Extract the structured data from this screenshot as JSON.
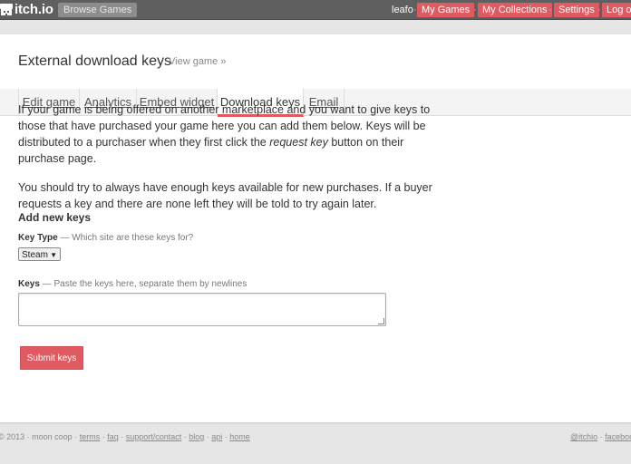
{
  "topbar": {
    "logo_text": "itch.io",
    "logo_icon": "itchio-logo-icon",
    "browse_label": "Browse Games",
    "username": "leafo",
    "nav": [
      "My Games",
      "My Collections",
      "Settings",
      "Log out"
    ],
    "separator": "·"
  },
  "header": {
    "title": "External download keys",
    "view_link": "View game »"
  },
  "tabs": [
    "Edit game",
    "Analytics",
    "Embed widget",
    "Download keys",
    "Email"
  ],
  "content": {
    "para1_a": "If your game is being offered on another marketplace and you want to give keys to those that have purchased your game here you can add them below. Keys will be distributed to a purchaser when they first click the ",
    "para1_em": "request key",
    "para1_b": " button on their purchase page.",
    "para2": "You should try to always have enough keys available for new purchases. If a buyer requests a key and there are none left they will be told to try again later.",
    "section_title": "Add new keys",
    "key_type_label": "Key Type",
    "key_type_hint": " — Which site are these keys for?",
    "key_type_value": "Steam",
    "keys_label": "Keys",
    "keys_hint": " — Paste the keys here, separate them by newlines",
    "submit_label": "Submit keys"
  },
  "footer": {
    "copyright": "© 2013 · moon coop · ",
    "links": [
      "terms",
      "faq",
      "support/contact",
      "blog",
      "api",
      "home"
    ],
    "right_links": [
      "@itchio",
      "facebook"
    ]
  },
  "colors": {
    "accent": "#e05b61",
    "topbar": "#5f5f5f",
    "background": "#e6e6e6"
  }
}
